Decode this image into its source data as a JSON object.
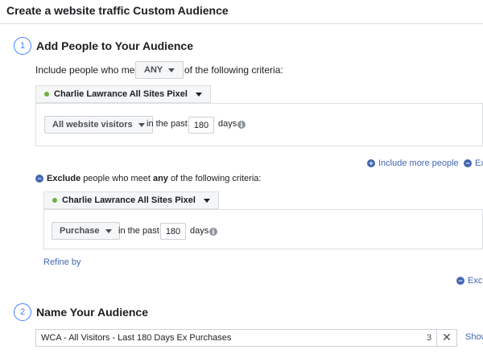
{
  "header": {
    "title": "Create a website traffic Custom Audience"
  },
  "step1": {
    "number": "1",
    "title": "Add People to Your Audience",
    "include": {
      "prefix": "Include people who meet",
      "mode": "ANY",
      "suffix": "of the following criteria:",
      "pixel": "Charlie Lawrance All Sites Pixel",
      "rule": "All website visitors",
      "in_the_past": "in the past",
      "days_value": "180",
      "days_label": "days"
    },
    "include_more_label": "Include more people",
    "exclude_link_label": "Exclu",
    "exclude": {
      "keyword": "Exclude",
      "text_before": "people who meet",
      "any": "any",
      "text_after": "of the following criteria:",
      "pixel": "Charlie Lawrance All Sites Pixel",
      "rule": "Purchase",
      "in_the_past": "in the past",
      "days_value": "180",
      "days_label": "days"
    },
    "refine_by": "Refine by",
    "exclude_link2_label": "Exclu"
  },
  "step2": {
    "number": "2",
    "title": "Name Your Audience",
    "name_value": "WCA - All Visitors - Last 180 Days Ex Purchases",
    "char_count": "3",
    "clear_glyph": "✕",
    "show_link": "Show"
  },
  "colors": {
    "accent": "#4267b2",
    "step_ring": "#4080ff",
    "pixel_active": "#6bb13b"
  }
}
